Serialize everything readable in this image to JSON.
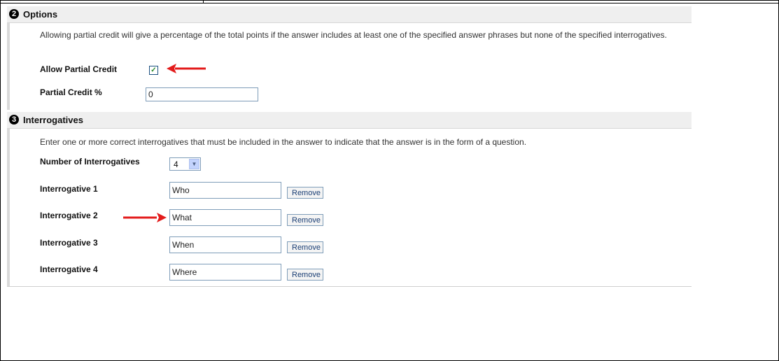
{
  "options": {
    "number": "2",
    "title": "Options",
    "description": "Allowing partial credit will give a percentage of the total points if the answer includes at least one of the specified answer phrases but none of the specified interrogatives.",
    "allow_partial_credit_label": "Allow Partial Credit",
    "allow_partial_credit_checked": true,
    "checkmark": "✓",
    "partial_credit_label": "Partial Credit %",
    "partial_credit_value": "0"
  },
  "interrogatives": {
    "number": "3",
    "title": "Interrogatives",
    "description": "Enter one or more correct interrogatives that must be included in the answer to indicate that the answer is in the form of a question.",
    "count_label": "Number of Interrogatives",
    "count_value": "4",
    "remove_label": "Remove",
    "items": [
      {
        "label": "Interrogative 1",
        "value": "Who"
      },
      {
        "label": "Interrogative 2",
        "value": "What"
      },
      {
        "label": "Interrogative 3",
        "value": "When"
      },
      {
        "label": "Interrogative 4",
        "value": "Where"
      }
    ]
  },
  "colors": {
    "annotation_arrow": "#e31b1b",
    "header_background": "#efefef",
    "checkbox_check": "#2a8a2a"
  }
}
